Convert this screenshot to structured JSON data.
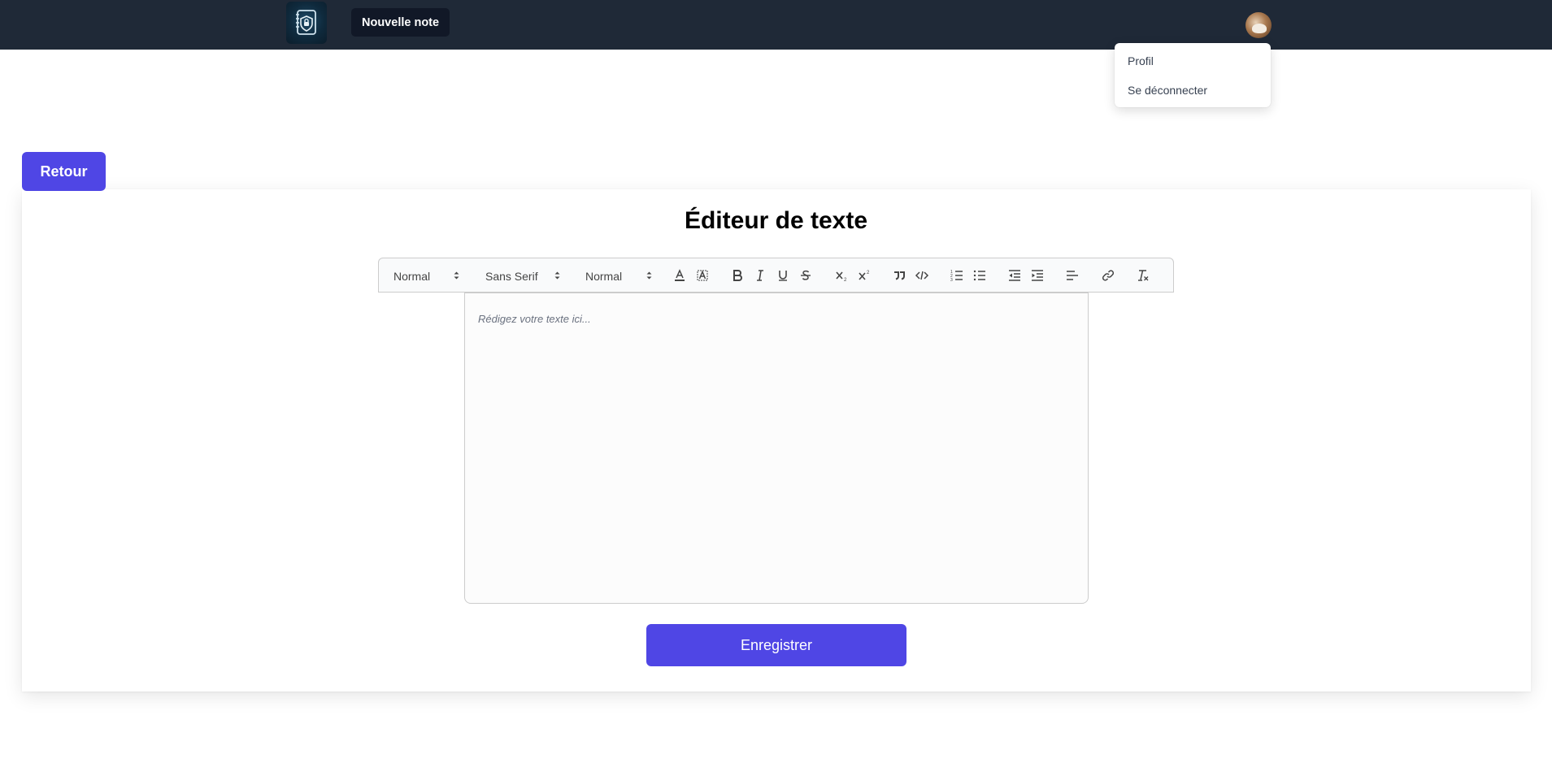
{
  "header": {
    "new_note_label": "Nouvelle note",
    "logo_icon": "notebook-lock-icon",
    "avatar_icon": "user-avatar"
  },
  "user_menu": {
    "items": [
      {
        "label": "Profil"
      },
      {
        "label": "Se déconnecter"
      }
    ]
  },
  "page": {
    "back_label": "Retour",
    "title": "Éditeur de texte",
    "save_label": "Enregistrer"
  },
  "toolbar": {
    "header_select": "Normal",
    "font_select": "Sans Serif",
    "size_select": "Normal",
    "buttons": [
      "text-color-icon",
      "background-color-icon",
      "bold-icon",
      "italic-icon",
      "underline-icon",
      "strikethrough-icon",
      "subscript-icon",
      "superscript-icon",
      "blockquote-icon",
      "code-icon",
      "ordered-list-icon",
      "bullet-list-icon",
      "outdent-icon",
      "indent-icon",
      "align-icon",
      "link-icon",
      "clear-format-icon"
    ]
  },
  "editor": {
    "placeholder": "Rédigez votre texte ici..."
  },
  "colors": {
    "navbar": "#1f2937",
    "accent": "#4f46e5",
    "dark_button": "#111827"
  }
}
